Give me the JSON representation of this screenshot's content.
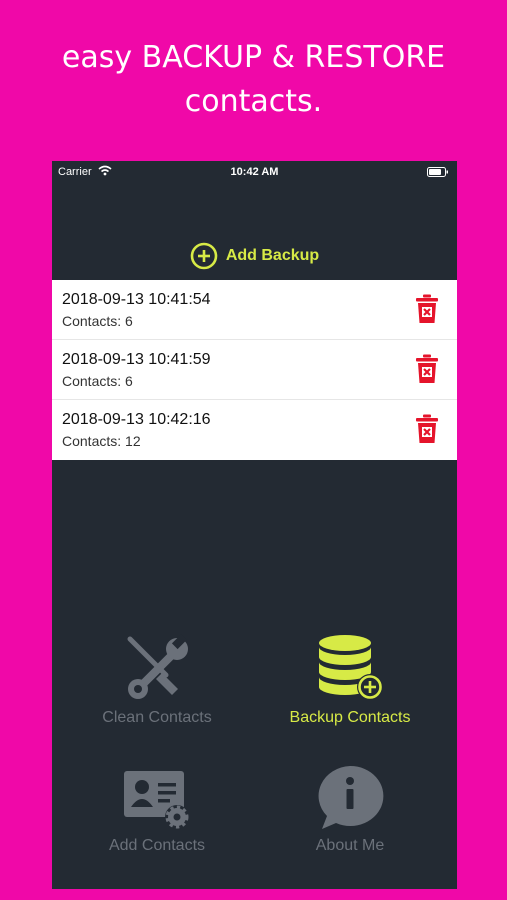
{
  "promo": {
    "line1": "easy BACKUP & RESTORE",
    "line2": "contacts."
  },
  "status_bar": {
    "carrier": "Carrier",
    "time": "10:42 AM"
  },
  "add_backup": {
    "label": "Add Backup",
    "icon": "plus-circle-icon"
  },
  "backups": [
    {
      "date": "2018-09-13 10:41:54",
      "contacts": "Contacts: 6"
    },
    {
      "date": "2018-09-13 10:41:59",
      "contacts": "Contacts: 6"
    },
    {
      "date": "2018-09-13 10:42:16",
      "contacts": "Contacts: 12"
    }
  ],
  "menu": {
    "clean": {
      "label": "Clean Contacts",
      "icon": "tools-icon"
    },
    "backup": {
      "label": "Backup Contacts",
      "icon": "database-add-icon"
    },
    "add": {
      "label": "Add Contacts",
      "icon": "contact-card-gear-icon"
    },
    "about": {
      "label": "About Me",
      "icon": "info-bubble-icon"
    }
  },
  "colors": {
    "background": "#f008a8",
    "screen": "#232a33",
    "accent": "#d7ea46",
    "inactive": "#6b717a",
    "delete": "#e5142b"
  }
}
